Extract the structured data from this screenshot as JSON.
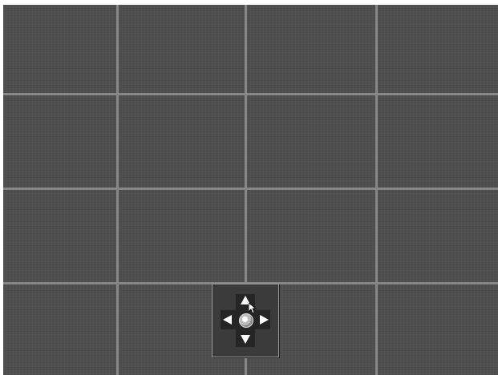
{
  "video_wall": {
    "rows": 4,
    "columns": 4,
    "cells": [
      "cell-1",
      "cell-2",
      "cell-3",
      "cell-4",
      "cell-5",
      "cell-6",
      "cell-7",
      "cell-8",
      "cell-9",
      "cell-10",
      "cell-11",
      "cell-12",
      "cell-13",
      "cell-14",
      "cell-15",
      "cell-16"
    ]
  },
  "ptz_control": {
    "icons": {
      "up": "arrow-up-icon",
      "down": "arrow-down-icon",
      "left": "arrow-left-icon",
      "right": "arrow-right-icon",
      "center": "home-center-icon"
    }
  },
  "colors": {
    "background": "#4e4e4e",
    "grid_lines": "#878787",
    "panel": "#3b3b3b",
    "arrows": "#ffffff"
  }
}
